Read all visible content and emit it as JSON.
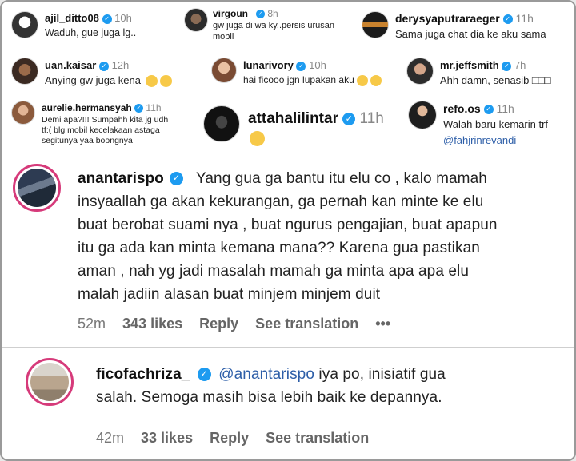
{
  "small_comments": [
    {
      "username": "ajil_ditto08",
      "time": "10h",
      "text": "Waduh, gue juga lg..",
      "verified": true
    },
    {
      "username": "virgoun_",
      "time": "8h",
      "text_lines": [
        "gw juga di wa ky..persis urusan",
        "mobil"
      ],
      "verified": true
    },
    {
      "username": "derysyaputraraeger",
      "time": "11h",
      "text": "Sama juga chat dia ke aku sama",
      "verified": true
    },
    {
      "username": "uan.kaisar",
      "time": "12h",
      "text": "Anying gw juga kena",
      "emojis": [
        "crying-face",
        "crying-face"
      ],
      "verified": true
    },
    {
      "username": "lunarivory",
      "time": "10h",
      "text": "hai ficooo jgn lupakan aku",
      "emojis": [
        "smiling-face",
        "smiling-face"
      ],
      "verified": true
    },
    {
      "username": "mr.jeffsmith",
      "time": "7h",
      "text": "Ahh damn, senasib",
      "trailing_glyphs": "□□□",
      "verified": true
    },
    {
      "username": "aurelie.hermansyah",
      "time": "11h",
      "text_lines": [
        "Demi apa?!!! Sumpahh kita jg udh",
        "tf:( blg mobil kecelakaan astaga",
        "segitunya yaa boongnya"
      ],
      "verified": true
    },
    {
      "username": "attahalilintar",
      "time": "11h",
      "emojis": [
        "sad-face"
      ],
      "verified": true
    },
    {
      "username": "refo.os",
      "time": "11h",
      "text": "Walah baru kemarin trf",
      "mention": "@fahjrinrevandi",
      "verified": true
    }
  ],
  "comment_main": {
    "username": "anantarispo",
    "verified": true,
    "text_lines": [
      "Yang gua ga bantu itu elu co , kalo mamah",
      "insyaallah ga akan kekurangan, ga pernah kan minte ke elu",
      "buat berobat suami nya , buat ngurus pengajian, buat apapun",
      "itu ga ada kan minta kemana mana?? Karena gua pastikan",
      "aman , nah yg jadi masalah mamah ga minta apa apa elu",
      "malah jadiin alasan buat minjem minjem duit"
    ],
    "time": "52m",
    "likes": "343 likes",
    "reply_label": "Reply",
    "translation_label": "See translation",
    "more_label": "•••"
  },
  "comment_reply": {
    "username": "ficofachriza_",
    "verified": true,
    "mention": "@anantarispo",
    "text_first": " iya po, inisiatif gua",
    "text_second": "salah. Semoga masih bisa lebih baik ke depannya.",
    "time": "42m",
    "likes": "33 likes",
    "reply_label": "Reply",
    "translation_label": "See translation"
  },
  "colors": {
    "verified_blue": "#1d9bf0",
    "mention_blue": "#2d5ea8",
    "story_ring": "#d63a7a"
  }
}
